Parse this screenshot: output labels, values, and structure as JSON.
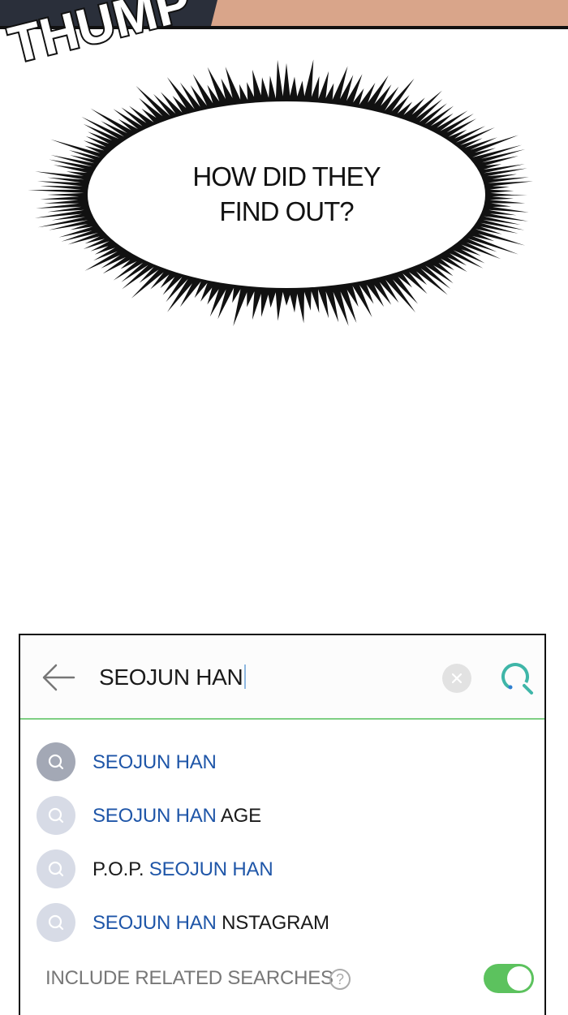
{
  "sfx_text": "THUMP",
  "bubble": {
    "line1": "HOW DID THEY",
    "line2": "FIND OUT?"
  },
  "search": {
    "query": "SEOJUN HAN",
    "suggestions": [
      {
        "parts": [
          {
            "text": "SEOJUN HAN",
            "style": "hl"
          }
        ],
        "active": true
      },
      {
        "parts": [
          {
            "text": "SEOJUN HAN",
            "style": "hl"
          },
          {
            "text": " AGE",
            "style": "plain"
          }
        ],
        "active": false
      },
      {
        "parts": [
          {
            "text": "P.O.P. ",
            "style": "plain"
          },
          {
            "text": "SEOJUN HAN",
            "style": "hl"
          }
        ],
        "active": false
      },
      {
        "parts": [
          {
            "text": "SEOJUN HAN",
            "style": "hl"
          },
          {
            "text": " NSTAGRAM",
            "style": "plain"
          }
        ],
        "active": false
      }
    ],
    "related_label": "INCLUDE RELATED SEARCHES",
    "help_glyph": "?",
    "related_enabled": true
  },
  "colors": {
    "highlight": "#1f56a8",
    "accent_green": "#5cc25e",
    "divider_green": "#7ecf83",
    "search_icon": "#3fb6a8"
  },
  "icons": [
    "back-arrow-icon",
    "clear-icon",
    "search-icon",
    "history-search-icon",
    "help-icon"
  ]
}
